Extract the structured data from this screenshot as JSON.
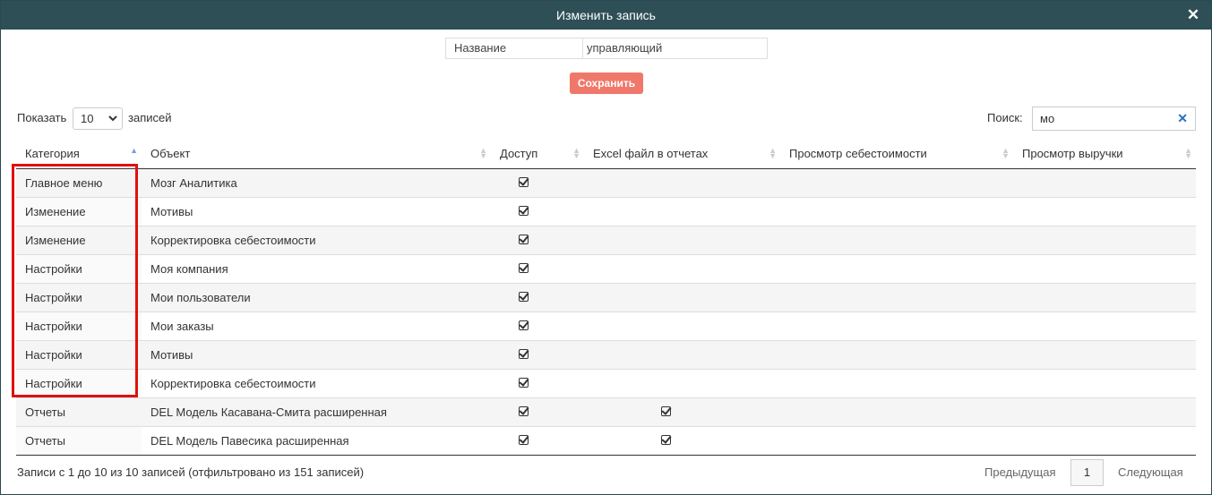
{
  "modal": {
    "title": "Изменить запись",
    "close_icon": "close-icon"
  },
  "form": {
    "name_label": "Название",
    "name_value": "управляющий",
    "save_label": "Сохранить"
  },
  "length": {
    "show_label": "Показать",
    "selected": "10",
    "records_label": "записей"
  },
  "search": {
    "label": "Поиск:",
    "value": "мо"
  },
  "columns": [
    "Категория",
    "Объект",
    "Доступ",
    "Excel файл в отчетах",
    "Просмотр себестоимости",
    "Просмотр выручки"
  ],
  "sorted_column": "Категория",
  "rows": [
    {
      "category": "Главное меню",
      "object": "Мозг Аналитика",
      "access": true,
      "excel": false
    },
    {
      "category": "Изменение",
      "object": "Мотивы",
      "access": true,
      "excel": false
    },
    {
      "category": "Изменение",
      "object": "Корректировка себестоимости",
      "access": true,
      "excel": false
    },
    {
      "category": "Настройки",
      "object": "Моя компания",
      "access": true,
      "excel": false
    },
    {
      "category": "Настройки",
      "object": "Мои пользователи",
      "access": true,
      "excel": false
    },
    {
      "category": "Настройки",
      "object": "Мои заказы",
      "access": true,
      "excel": false
    },
    {
      "category": "Настройки",
      "object": "Мотивы",
      "access": true,
      "excel": false
    },
    {
      "category": "Настройки",
      "object": "Корректировка себестоимости",
      "access": true,
      "excel": false
    },
    {
      "category": "Отчеты",
      "object": "DEL Модель Касавана-Смита расширенная",
      "access": true,
      "excel": true
    },
    {
      "category": "Отчеты",
      "object": "DEL Модель Павесика расширенная",
      "access": true,
      "excel": true
    }
  ],
  "footer": {
    "info": "Записи с 1 до 10 из 10 записей (отфильтровано из 151 записей)",
    "prev": "Предыдущая",
    "page": "1",
    "next": "Следующая"
  },
  "colors": {
    "header_bg": "#2f4f57",
    "save_btn": "#f0786a",
    "highlight": "#e01010"
  }
}
